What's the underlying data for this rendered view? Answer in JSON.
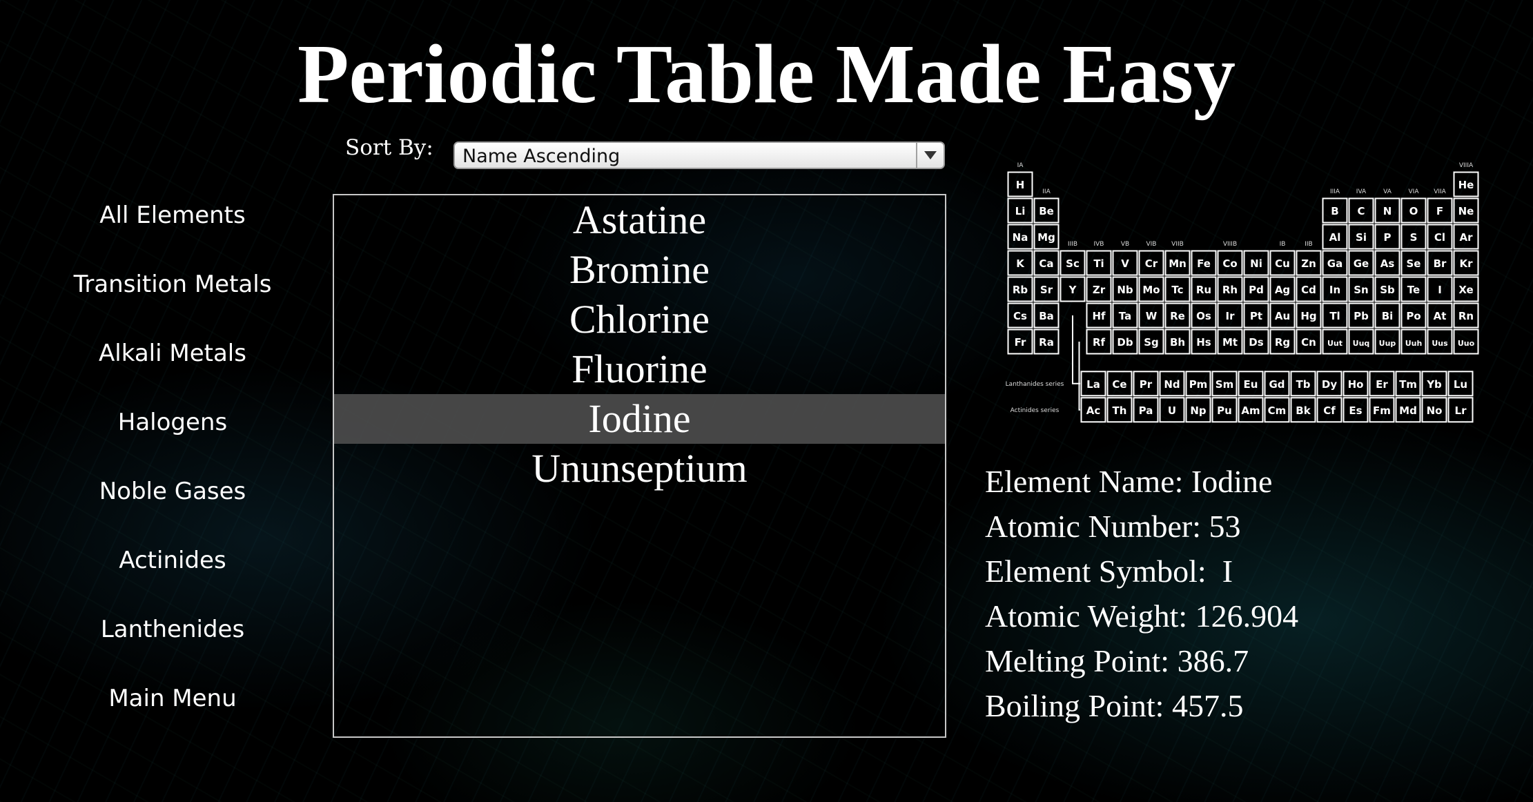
{
  "title": "Periodic Table Made Easy",
  "sort": {
    "label": "Sort By:",
    "selected": "Name Ascending"
  },
  "nav": [
    {
      "label": "All Elements"
    },
    {
      "label": "Transition Metals"
    },
    {
      "label": "Alkali Metals"
    },
    {
      "label": "Halogens"
    },
    {
      "label": "Noble Gases"
    },
    {
      "label": "Actinides"
    },
    {
      "label": "Lanthenides"
    },
    {
      "label": "Main Menu"
    }
  ],
  "elements_list": {
    "items": [
      "Astatine",
      "Bromine",
      "Chlorine",
      "Fluorine",
      "Iodine",
      "Ununseptium"
    ],
    "selected": "Iodine"
  },
  "details": {
    "name": "Element Name: Iodine",
    "atomic_number": "Atomic Number: 53",
    "symbol": "Element Symbol:  I",
    "weight": "Atomic Weight: 126.904",
    "melting": "Melting Point: 386.7",
    "boiling": "Boiling Point: 457.5"
  },
  "periodic_table": {
    "group_labels": [
      "IA",
      "IIA",
      "IIIA",
      "IVA",
      "VA",
      "VIA",
      "VIIA",
      "VIIIA",
      "IIIB",
      "IVB",
      "VB",
      "VIB",
      "VIIB",
      "VIIIB",
      "IB",
      "IIB"
    ],
    "rows": [
      [
        "H",
        "",
        "",
        "",
        "",
        "",
        "",
        "",
        "",
        "",
        "",
        "",
        "",
        "",
        "",
        "",
        "",
        "He"
      ],
      [
        "Li",
        "Be",
        "",
        "",
        "",
        "",
        "",
        "",
        "",
        "",
        "",
        "",
        "B",
        "C",
        "N",
        "O",
        "F",
        "Ne"
      ],
      [
        "Na",
        "Mg",
        "",
        "",
        "",
        "",
        "",
        "",
        "",
        "",
        "",
        "",
        "Al",
        "Si",
        "P",
        "S",
        "Cl",
        "Ar"
      ],
      [
        "K",
        "Ca",
        "Sc",
        "Ti",
        "V",
        "Cr",
        "Mn",
        "Fe",
        "Co",
        "Ni",
        "Cu",
        "Zn",
        "Ga",
        "Ge",
        "As",
        "Se",
        "Br",
        "Kr"
      ],
      [
        "Rb",
        "Sr",
        "Y",
        "Zr",
        "Nb",
        "Mo",
        "Tc",
        "Ru",
        "Rh",
        "Pd",
        "Ag",
        "Cd",
        "In",
        "Sn",
        "Sb",
        "Te",
        "I",
        "Xe"
      ],
      [
        "Cs",
        "Ba",
        "",
        "Hf",
        "Ta",
        "W",
        "Re",
        "Os",
        "Ir",
        "Pt",
        "Au",
        "Hg",
        "Tl",
        "Pb",
        "Bi",
        "Po",
        "At",
        "Rn"
      ],
      [
        "Fr",
        "Ra",
        "",
        "Rf",
        "Db",
        "Sg",
        "Bh",
        "Hs",
        "Mt",
        "Ds",
        "Rg",
        "Cn",
        "Uut",
        "Uuq",
        "Uup",
        "Uuh",
        "Uus",
        "Uuo"
      ]
    ],
    "lanthanides_label": "Lanthanides series",
    "actinides_label": "Actinides series",
    "lanthanides": [
      "La",
      "Ce",
      "Pr",
      "Nd",
      "Pm",
      "Sm",
      "Eu",
      "Gd",
      "Tb",
      "Dy",
      "Ho",
      "Er",
      "Tm",
      "Yb",
      "Lu"
    ],
    "actinides": [
      "Ac",
      "Th",
      "Pa",
      "U",
      "Np",
      "Pu",
      "Am",
      "Cm",
      "Bk",
      "Cf",
      "Es",
      "Fm",
      "Md",
      "No",
      "Lr"
    ]
  }
}
